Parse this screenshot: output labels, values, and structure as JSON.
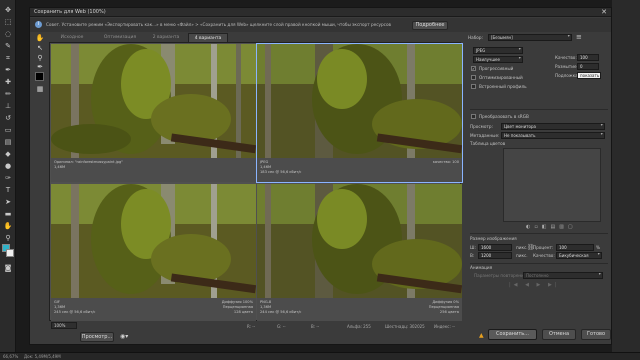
{
  "dialog": {
    "title": "Сохранить для Web (100%)",
    "tip": "Совет. Установите режим «Экспортировать как...» в меню «Файл» > «Сохранить для Web» щелкните слой правой кнопкой мыши, чтобы экспорт ресурсов",
    "more_button": "Подробнее",
    "close_glyph": "✕"
  },
  "tabs": [
    {
      "label": "Исходное"
    },
    {
      "label": "Оптимизация"
    },
    {
      "label": "2 варианта"
    },
    {
      "label": "4 варианта"
    }
  ],
  "panes": [
    {
      "line1": "Оригинал: \"rainforestmossypaint.jpg\"",
      "line2": "1,46М",
      "line3": ""
    },
    {
      "line1": "JPEG",
      "line2": "1,46М",
      "line3": "183 сек @ 56,6 кбит/с",
      "right1": "качество: 100"
    },
    {
      "line1": "GIF",
      "line2": "1,36М",
      "line3": "245 сек @ 56,6 кбит/с",
      "right1": "Диффузия 100%",
      "right2": "Перцепционная",
      "right3": "128 цвета"
    },
    {
      "line1": "PNG-8",
      "line2": "1,36М",
      "line3": "244 сек @ 56,6 кбит/с",
      "right1": "Диффузия 0%",
      "right2": "Перцепционная",
      "right3": "256 цвета"
    }
  ],
  "bottom": {
    "zoom": "100%",
    "r": "R: --",
    "g": "G: --",
    "b": "B: --",
    "alpha": "Альфа: 255",
    "hex": "Шестнадц: 302025",
    "index": "Индекс: --"
  },
  "settings": {
    "preset_label": "Набор:",
    "preset_value": "[Безымян]",
    "format": "JPEG",
    "quality_mode": "Наилучшее",
    "quality_label": "Качество:",
    "quality_value": "100",
    "progressive": "Прогрессивный",
    "blur_label": "Размытие:",
    "blur_value": "0",
    "optimized": "Оптимизированный",
    "matte_label": "Подложка:",
    "matte_value": "показать",
    "embed_profile": "Встроенный профиль",
    "convert_srgb": "Преобразовать в sRGB",
    "preview_label": "Просмотр:",
    "preview_value": "Цвет монитора",
    "metadata_label": "Метаданные:",
    "metadata_value": "Не показывать",
    "color_table_label": "Таблица цветов",
    "image_size_label": "Размер изображения",
    "w_label": "Ш:",
    "w_value": "1600",
    "h_label": "В:",
    "h_value": "1200",
    "unit_px": "пикс.",
    "percent_label": "Процент:",
    "percent_value": "100",
    "percent_unit": "%",
    "resample_label": "Качество:",
    "resample_value": "Бикубическая",
    "animation_label": "Анимация",
    "loop_label": "Параметры повторения:",
    "loop_value": "Постоянно"
  },
  "buttons": {
    "preview": "Просмотр...",
    "save": "Сохранить...",
    "cancel": "Отмена",
    "done": "Готово"
  },
  "status": {
    "zoom": "66,67%",
    "doc": "Док: 5,49М/5,49М"
  },
  "icons": {
    "warning": "warning-icon",
    "browser": "browser-icon"
  }
}
